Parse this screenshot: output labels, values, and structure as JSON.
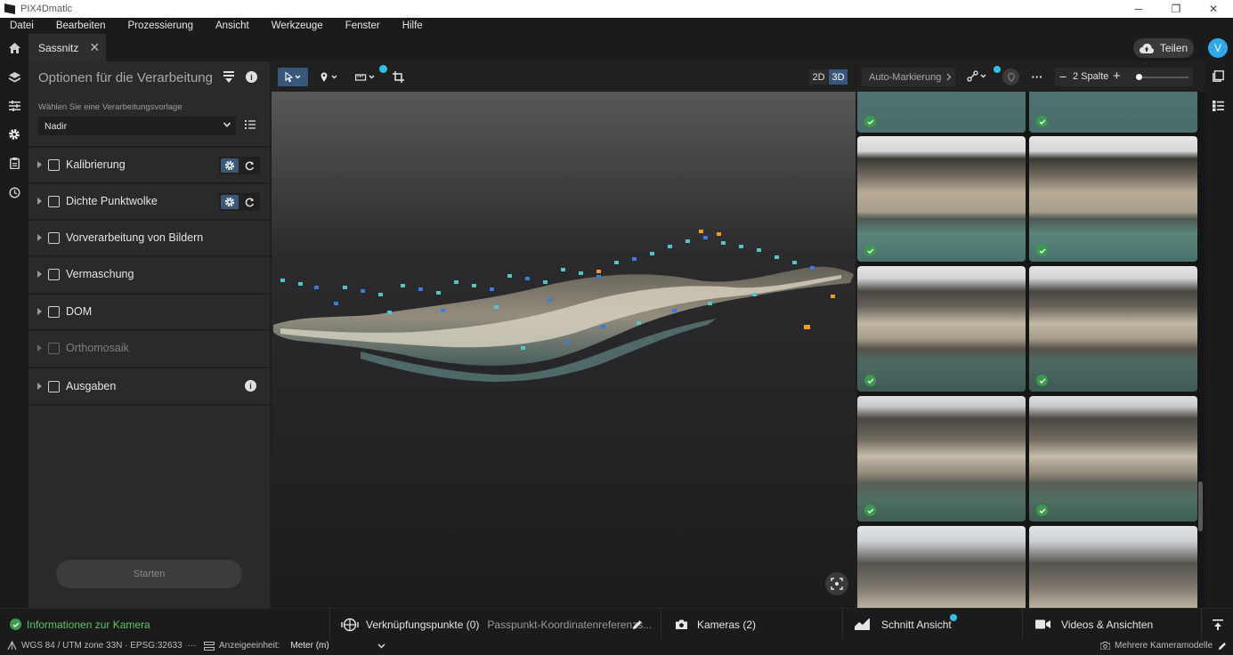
{
  "window": {
    "title": "PIX4Dmatic",
    "minimize": "─",
    "restore": "❐",
    "close": "✕"
  },
  "menu": [
    "Datei",
    "Bearbeiten",
    "Prozessierung",
    "Ansicht",
    "Werkzeuge",
    "Fenster",
    "Hilfe"
  ],
  "tab": {
    "label": "Sassnitz",
    "close": "✕"
  },
  "share": {
    "label": "Teilen"
  },
  "user": {
    "initial": "V"
  },
  "left_panel": {
    "title": "Optionen für die Verarbeitung",
    "template_label": "Wählen Sie eine Verarbeitungsvorlage",
    "template_value": "Nadir",
    "steps": [
      {
        "label": "Kalibrierung",
        "enabled": true,
        "settings": true
      },
      {
        "label": "Dichte Punktwolke",
        "enabled": true,
        "settings": true
      },
      {
        "label": "Vorverarbeitung von Bildern",
        "enabled": true
      },
      {
        "label": "Vermaschung",
        "enabled": true
      },
      {
        "label": "DOM",
        "enabled": true
      },
      {
        "label": "Orthomosaik",
        "enabled": false
      },
      {
        "label": "Ausgaben",
        "enabled": true,
        "info": true
      }
    ],
    "start_button": "Starten",
    "info_glyph": "i"
  },
  "viewport": {
    "mode_2d": "2D",
    "mode_3d": "3D",
    "active_mode": "3D"
  },
  "right_panel": {
    "auto_marking": "Auto-Markierung",
    "columns_label": "2 Spalte",
    "minus": "−",
    "plus": "+"
  },
  "bottom": {
    "camera_info": "Informationen zur Kamera",
    "tie_points": "Verknüpfungspunkte (0)",
    "gcp_ref": "Passpunkt-Koordinatenreferenzs...",
    "cameras": "Kameras (2)",
    "section_view": "Schnitt Ansicht",
    "videos": "Videos & Ansichten"
  },
  "status": {
    "crs": "WGS 84 / UTM zone 33N · EPSG:32633",
    "crs_more": "···",
    "unit_label": "Anzeigeeinheit:",
    "unit_value": "Meter (m)",
    "camera_models": "Mehrere Kameramodelle"
  },
  "colors": {
    "accent": "#2fa8ea",
    "active_blue": "#37587a",
    "check_green": "#3a9b4a"
  }
}
